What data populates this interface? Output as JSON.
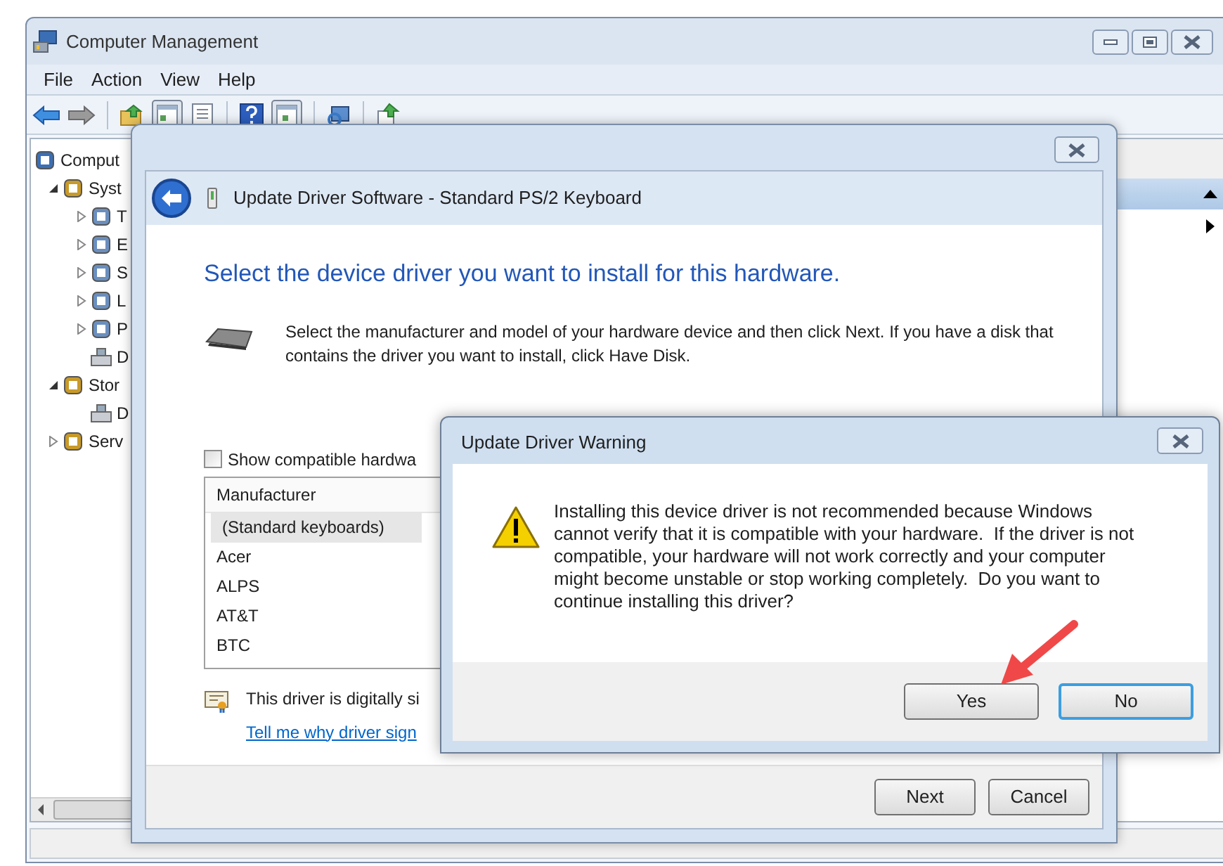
{
  "main_window": {
    "title": "Computer Management",
    "menu": [
      "File",
      "Action",
      "View",
      "Help"
    ],
    "tree": [
      {
        "label": "Comput",
        "kind": "node",
        "children": [
          {
            "label": "Syst",
            "kind": "node",
            "expanded": true,
            "children": [
              {
                "label": "T",
                "kind": "node",
                "expanded": false
              },
              {
                "label": "E",
                "kind": "node",
                "expanded": false
              },
              {
                "label": "S",
                "kind": "node",
                "expanded": false
              },
              {
                "label": "L",
                "kind": "node",
                "expanded": false
              },
              {
                "label": "P",
                "kind": "node",
                "expanded": false
              },
              {
                "label": "D",
                "kind": "leaf"
              }
            ]
          },
          {
            "label": "Stor",
            "kind": "node",
            "expanded": true,
            "children": [
              {
                "label": "D",
                "kind": "leaf"
              }
            ]
          },
          {
            "label": "Serv",
            "kind": "node",
            "expanded": false
          }
        ]
      }
    ]
  },
  "wizard": {
    "title": "Update Driver Software - Standard PS/2 Keyboard",
    "heading": "Select the device driver you want to install for this hardware.",
    "description": "Select the manufacturer and model of your hardware device and then click Next. If you have a disk that contains the driver you want to install, click Have Disk.",
    "checkbox": {
      "label": "Show compatible hardwa",
      "checked": false
    },
    "list": {
      "header": "Manufacturer",
      "items": [
        {
          "label": "(Standard keyboards)",
          "selected": true
        },
        {
          "label": "Acer",
          "selected": false
        },
        {
          "label": "ALPS",
          "selected": false
        },
        {
          "label": "AT&T",
          "selected": false
        },
        {
          "label": "BTC",
          "selected": false
        }
      ]
    },
    "signed_text": "This driver is digitally si",
    "link": "Tell me why driver sign",
    "buttons": [
      {
        "label": "Next",
        "default": false
      },
      {
        "label": "Cancel",
        "default": false
      }
    ]
  },
  "warning": {
    "title": "Update Driver Warning",
    "message": "Installing this device driver is not recommended because Windows cannot verify that it is compatible with your hardware.  If the driver is not compatible, your hardware will not work correctly and your computer might become unstable or stop working completely.  Do you want to continue installing this driver?",
    "buttons": [
      {
        "label": "Yes",
        "default": false
      },
      {
        "label": "No",
        "default": true
      }
    ]
  }
}
